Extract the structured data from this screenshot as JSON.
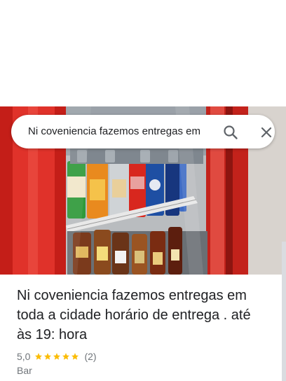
{
  "search": {
    "query": "Ni coveniencia fazemos entregas em",
    "search_icon": "search-icon",
    "clear_icon": "close-icon"
  },
  "place": {
    "title": "Ni coveniencia fazemos entregas em toda a cidade horário de entrega . até às 19: hora",
    "rating": "5,0",
    "stars": 5,
    "review_count": "(2)",
    "category": "Bar"
  },
  "colors": {
    "star": "#fbbc04",
    "fridge_red": "#d3221c",
    "text_primary": "#202124",
    "text_secondary": "#70757a"
  }
}
